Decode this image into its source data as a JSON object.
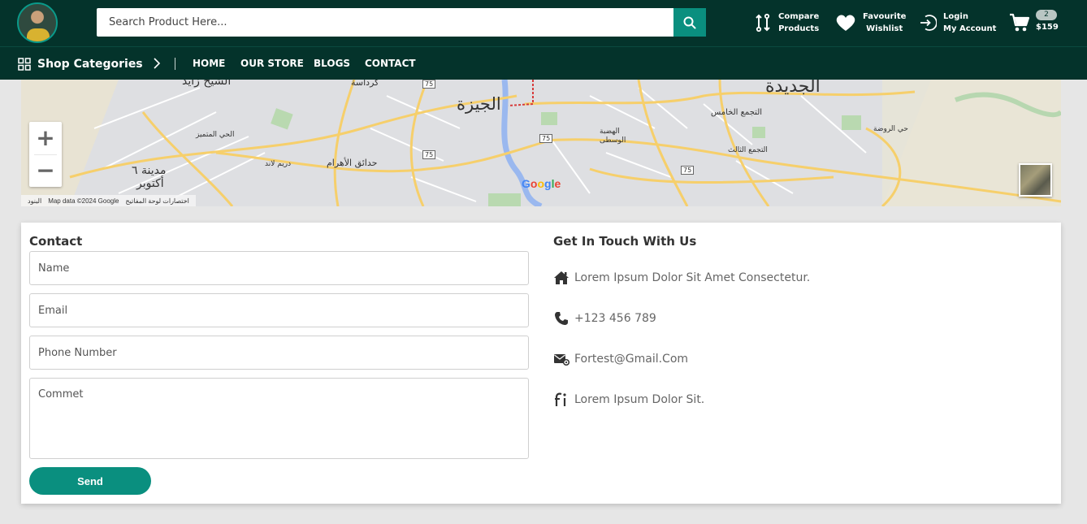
{
  "header": {
    "search_placeholder": "Search Product Here...",
    "compare": {
      "line1": "Compare",
      "line2": "Products"
    },
    "wishlist": {
      "line1": "Favourite",
      "line2": "Wishlist"
    },
    "account": {
      "line1": "Login",
      "line2": "My Account"
    },
    "cart": {
      "count": "2",
      "total": "$159"
    }
  },
  "nav": {
    "shop_categories": "Shop Categories",
    "links": [
      "HOME",
      "OUR STORE",
      "BLOGS",
      "CONTACT"
    ]
  },
  "map": {
    "labels": {
      "giza": "الجيزة",
      "new_cairo": "الجديدة",
      "sheikh_zayed": "الشيخ زايد",
      "kerdasa": "كرداسة",
      "october_1": "مدينة ٦",
      "october_2": "أكتوبر",
      "hadaeq_ahram": "حدائق الأهرام",
      "hay_motamayez": "الحي المتميز",
      "dream_land": "دريم لاند",
      "fifth_settlement": "التجمع الخامس",
      "third_settlement": "التجمع الثالث",
      "wosta_plateau_1": "الهضبة",
      "wosta_plateau_2": "الوسطى",
      "hay_rawda": "حي الروضة",
      "road_75": "75"
    },
    "zoom_in": "+",
    "zoom_out": "−",
    "google": [
      "G",
      "o",
      "o",
      "g",
      "l",
      "e"
    ],
    "attribution": [
      "البنود",
      "Map data ©2024 Google",
      "اختصارات لوحة المفاتيح"
    ]
  },
  "contact": {
    "title": "Contact",
    "name_placeholder": "Name",
    "email_placeholder": "Email",
    "phone_placeholder": "Phone Number",
    "comment_placeholder": "Commet",
    "send_label": "Send"
  },
  "touch": {
    "title": "Get In Touch With Us",
    "address": "Lorem Ipsum Dolor Sit Amet Consectetur.",
    "phone": "+123 456 789",
    "email": "Fortest@Gmail.Com",
    "info": "Lorem Ipsum Dolor Sit."
  },
  "colors": {
    "header_bg": "#04332b",
    "accent": "#0a8f7f",
    "page_bg": "#e6e6e6"
  }
}
